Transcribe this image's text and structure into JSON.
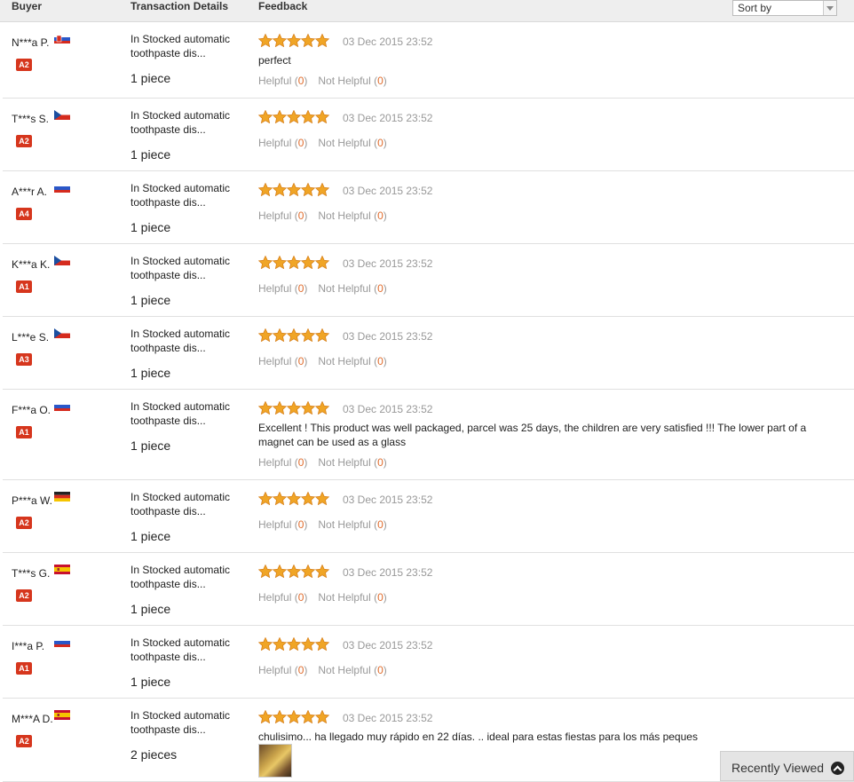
{
  "header": {
    "buyer": "Buyer",
    "transaction": "Transaction Details",
    "feedback": "Feedback",
    "sort_label": "Sort by"
  },
  "colors": {
    "badge": "#d6361d",
    "count": "#e06d2e",
    "star": "#f0a526"
  },
  "rows": [
    {
      "buyer": "N***a P.",
      "flag": "slovakia",
      "level": "A2",
      "product": "In Stocked automatic toothpaste dis...",
      "qty": "1 piece",
      "rating": 5,
      "date": "03 Dec 2015 23:52",
      "feedback": "perfect",
      "helpful_label": "Helpful",
      "helpful_count": "0",
      "not_helpful_label": "Not Helpful",
      "not_helpful_count": "0"
    },
    {
      "buyer": "T***s S.",
      "flag": "czech",
      "level": "A2",
      "product": "In Stocked automatic toothpaste dis...",
      "qty": "1 piece",
      "rating": 5,
      "date": "03 Dec 2015 23:52",
      "feedback": "",
      "helpful_label": "Helpful",
      "helpful_count": "0",
      "not_helpful_label": "Not Helpful",
      "not_helpful_count": "0"
    },
    {
      "buyer": "A***r A.",
      "flag": "russia",
      "level": "A4",
      "product": "In Stocked automatic toothpaste dis...",
      "qty": "1 piece",
      "rating": 5,
      "date": "03 Dec 2015 23:52",
      "feedback": "",
      "helpful_label": "Helpful",
      "helpful_count": "0",
      "not_helpful_label": "Not Helpful",
      "not_helpful_count": "0"
    },
    {
      "buyer": "K***a K.",
      "flag": "czech",
      "level": "A1",
      "product": "In Stocked automatic toothpaste dis...",
      "qty": "1 piece",
      "rating": 5,
      "date": "03 Dec 2015 23:52",
      "feedback": "",
      "helpful_label": "Helpful",
      "helpful_count": "0",
      "not_helpful_label": "Not Helpful",
      "not_helpful_count": "0"
    },
    {
      "buyer": "L***e S.",
      "flag": "czech",
      "level": "A3",
      "product": "In Stocked automatic toothpaste dis...",
      "qty": "1 piece",
      "rating": 5,
      "date": "03 Dec 2015 23:52",
      "feedback": "",
      "helpful_label": "Helpful",
      "helpful_count": "0",
      "not_helpful_label": "Not Helpful",
      "not_helpful_count": "0"
    },
    {
      "buyer": "F***a O.",
      "flag": "russia",
      "level": "A1",
      "product": "In Stocked automatic toothpaste dis...",
      "qty": "1 piece",
      "rating": 5,
      "date": "03 Dec 2015 23:52",
      "feedback": "Excellent ! This product was well packaged, parcel was 25 days, the children are very satisfied !!! The lower part of a magnet can be used as a glass",
      "helpful_label": "Helpful",
      "helpful_count": "0",
      "not_helpful_label": "Not Helpful",
      "not_helpful_count": "0"
    },
    {
      "buyer": "P***a W.",
      "flag": "germany",
      "level": "A2",
      "product": "In Stocked automatic toothpaste dis...",
      "qty": "1 piece",
      "rating": 5,
      "date": "03 Dec 2015 23:52",
      "feedback": "",
      "helpful_label": "Helpful",
      "helpful_count": "0",
      "not_helpful_label": "Not Helpful",
      "not_helpful_count": "0"
    },
    {
      "buyer": "T***s G.",
      "flag": "spain",
      "level": "A2",
      "product": "In Stocked automatic toothpaste dis...",
      "qty": "1 piece",
      "rating": 5,
      "date": "03 Dec 2015 23:52",
      "feedback": "",
      "helpful_label": "Helpful",
      "helpful_count": "0",
      "not_helpful_label": "Not Helpful",
      "not_helpful_count": "0"
    },
    {
      "buyer": "I***a P.",
      "flag": "russia",
      "level": "A1",
      "product": "In Stocked automatic toothpaste dis...",
      "qty": "1 piece",
      "rating": 5,
      "date": "03 Dec 2015 23:52",
      "feedback": "",
      "helpful_label": "Helpful",
      "helpful_count": "0",
      "not_helpful_label": "Not Helpful",
      "not_helpful_count": "0"
    },
    {
      "buyer": "M***A D.",
      "flag": "spain",
      "level": "A2",
      "product": "In Stocked automatic toothpaste dis...",
      "qty": "2 pieces",
      "rating": 5,
      "date": "03 Dec 2015 23:52",
      "feedback": "chulisimo... ha llegado muy rápido en 22 días. .. ideal para estas fiestas para los más peques",
      "has_photo": true
    }
  ],
  "recently_viewed": {
    "label": "Recently Viewed",
    "icon": "chevron-up-circle-icon"
  }
}
